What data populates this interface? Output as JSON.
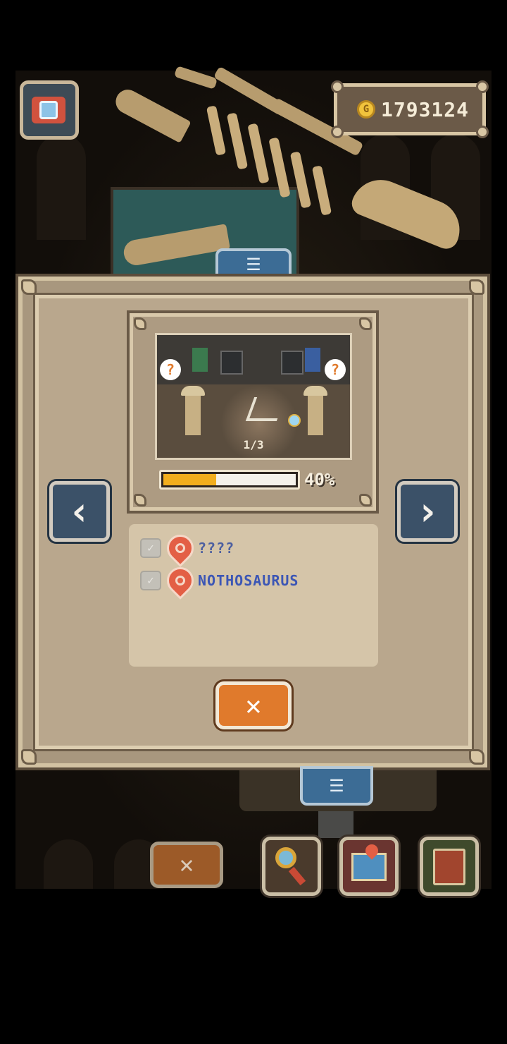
{
  "hud": {
    "camera_icon": "camera-icon",
    "coins": "1793124",
    "coin_symbol": "G"
  },
  "modal": {
    "page_indicator": "1/3",
    "progress": {
      "label": "40%",
      "fraction": 0.4
    },
    "prev_icon": "chevron-left-icon",
    "prev_glyph": "‹",
    "next_icon": "chevron-right-icon",
    "next_glyph": "›",
    "question_mark": "?",
    "items": [
      {
        "label": "????",
        "checked": true,
        "color": "#4c5fa0"
      },
      {
        "label": "NOTHOSAURUS",
        "checked": true,
        "color": "#3c56b5"
      }
    ],
    "close_glyph": "✕"
  },
  "bottom_bar": {
    "menu_glyph": "☰",
    "x_glyph": "✕"
  },
  "colors": {
    "panel": "#b9a78d",
    "accent_orange": "#e07a2c",
    "nav_blue": "#3b5168",
    "progress_fill": "#f2ae1e"
  }
}
